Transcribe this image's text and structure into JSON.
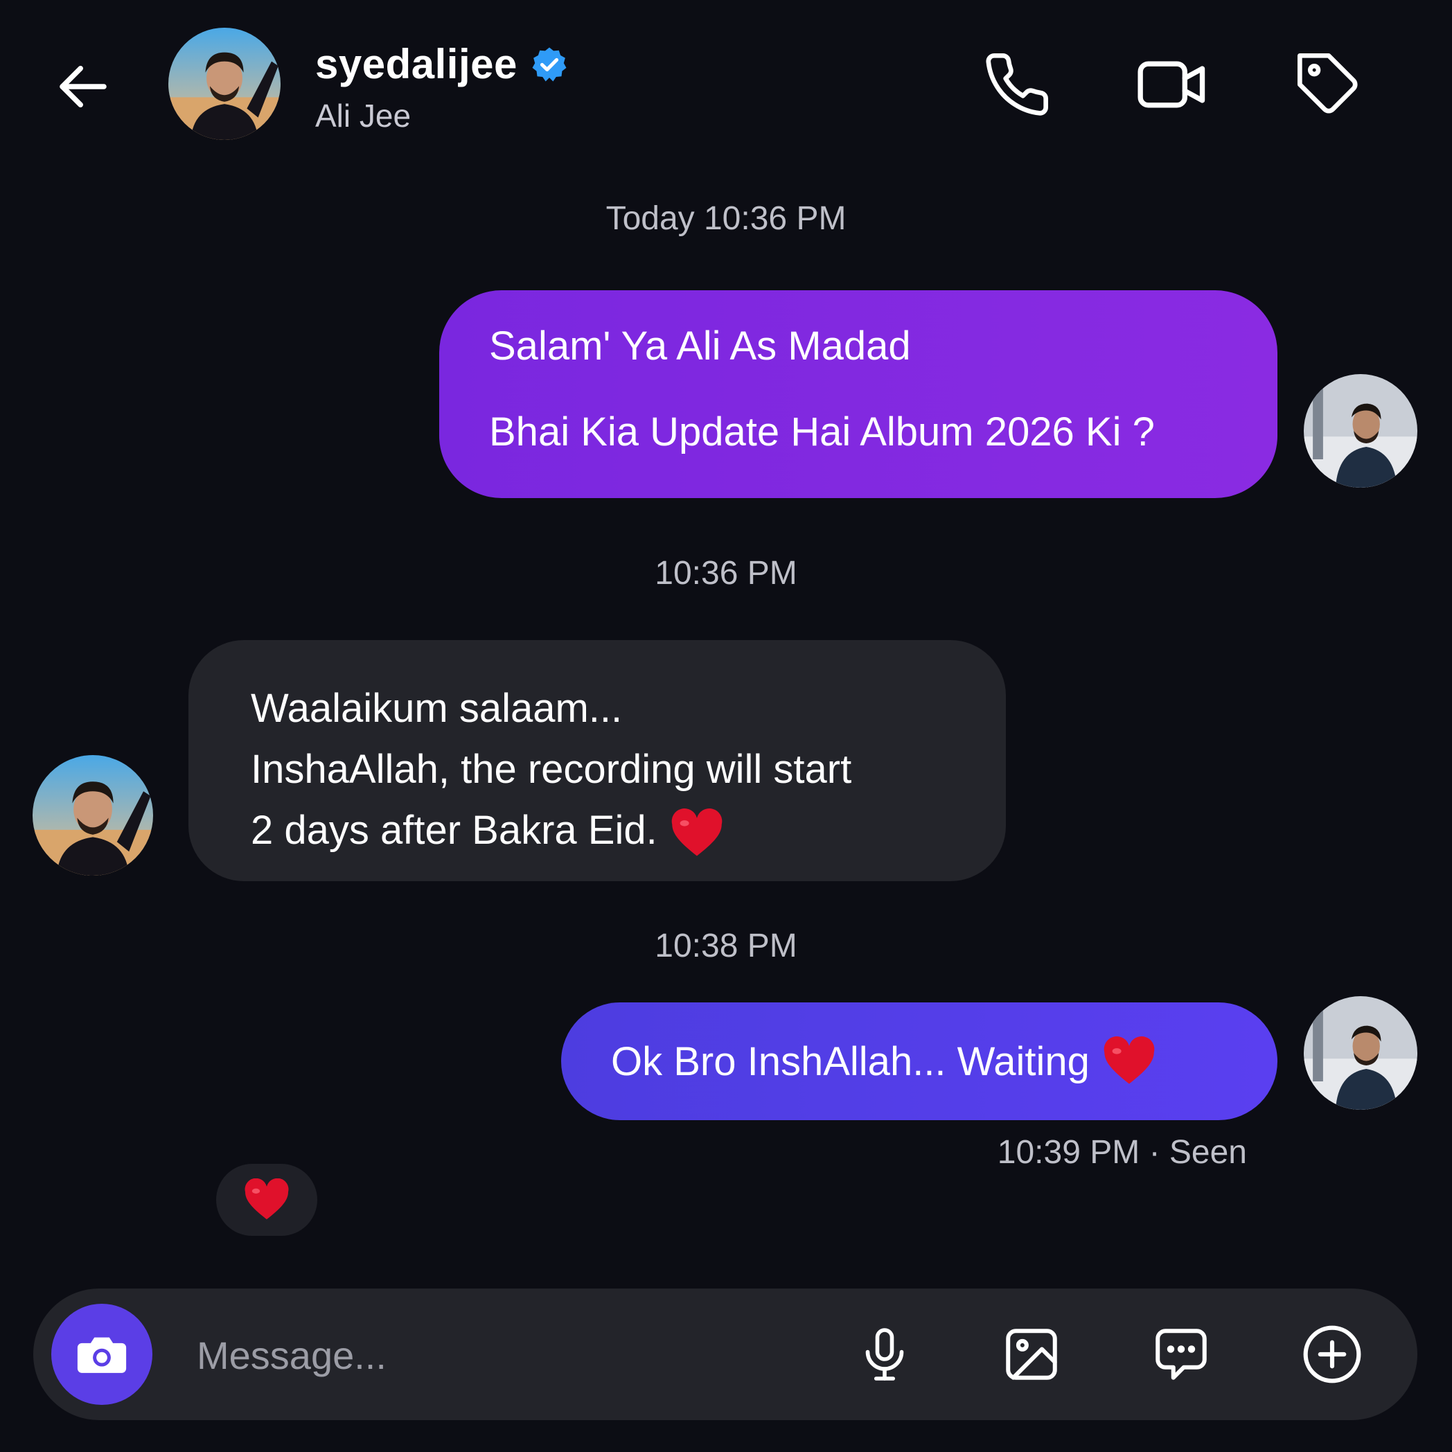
{
  "header": {
    "username": "syedalijee",
    "full_name": "Ali Jee",
    "verified": true,
    "icons": [
      "back-arrow-icon",
      "phone-icon",
      "video-camera-icon",
      "tag-icon"
    ]
  },
  "conversation": {
    "timestamps": {
      "first": "Today 10:36 PM",
      "second": "10:36 PM",
      "third": "10:38 PM"
    },
    "messages": [
      {
        "sender": "me",
        "lines": [
          "Salam' Ya Ali As Madad",
          "Bhai Kia Update Hai Album 2026 Ki ?"
        ]
      },
      {
        "sender": "them",
        "lines": [
          "Waalaikum salaam...",
          "InshaAllah, the recording will start",
          "2 days after Bakra Eid."
        ],
        "emoji": "heart"
      },
      {
        "sender": "me",
        "lines": [
          "Ok Bro InshAllah... Waiting"
        ],
        "emoji": "heart"
      }
    ],
    "seen_status": "10:39 PM · Seen",
    "reaction": "heart"
  },
  "composer": {
    "placeholder": "Message...",
    "icons": [
      "camera-icon",
      "microphone-icon",
      "gallery-icon",
      "sticker-icon",
      "plus-icon"
    ]
  },
  "colors": {
    "background": "#0c0d14",
    "outgoing_bubble_1": "#8a2be2",
    "outgoing_bubble_2": "#5a3ff0",
    "incoming_bubble": "#23242a",
    "verified_badge": "#2f9bf7",
    "camera_button": "#5b3ee6",
    "heart": "#e0112b"
  }
}
